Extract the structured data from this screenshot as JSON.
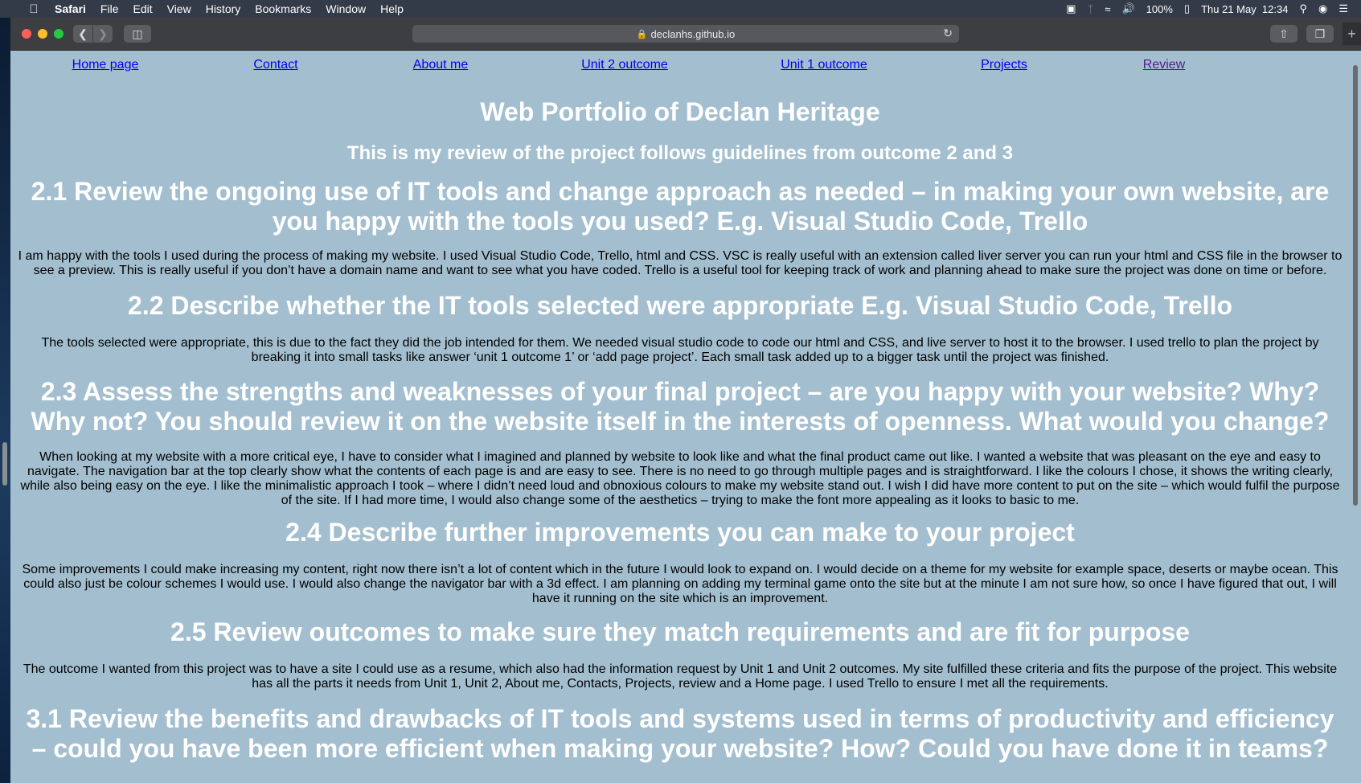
{
  "menubar": {
    "app": "Safari",
    "items": [
      "File",
      "Edit",
      "View",
      "History",
      "Bookmarks",
      "Window",
      "Help"
    ],
    "battery": "100%",
    "clock": "Thu 21 May  12:34"
  },
  "browser": {
    "url": "declanhs.github.io"
  },
  "nav": {
    "links": [
      "Home page",
      "Contact",
      "About me",
      "Unit 2 outcome",
      "Unit 1 outcome",
      "Projects",
      "Review"
    ]
  },
  "page": {
    "title": "Web Portfolio of Declan Heritage",
    "subtitle": "This is my review of the project follows guidelines from outcome 2 and 3",
    "sections": [
      {
        "heading": "2.1 Review the ongoing use of IT tools and change approach as needed – in making your own website, are you happy with the tools you used? E.g. Visual Studio Code, Trello",
        "body": "I am happy with the tools I used during the process of making my website. I used Visual Studio Code, Trello, html and CSS. VSC is really useful with an extension called liver server you can run your html and CSS file in the browser to see a preview. This is really useful if you don’t have a domain name and want to see what you have coded. Trello is a useful tool for keeping track of work and planning ahead to make sure the project was done on time or before."
      },
      {
        "heading": "2.2 Describe whether the IT tools selected were appropriate E.g. Visual Studio Code, Trello",
        "body": "The tools selected were appropriate, this is due to the fact they did the job intended for them. We needed visual studio code to code our html and CSS, and live server to host it to the browser. I used trello to plan the project by breaking it into small tasks like answer ‘unit 1 outcome 1’ or ‘add page project’. Each small task added up to a bigger task until the project was finished."
      },
      {
        "heading": "2.3 Assess the strengths and weaknesses of your final project – are you happy with your website? Why? Why not? You should review it on the website itself in the interests of openness. What would you change?",
        "body": "When looking at my website with a more critical eye, I have to consider what I imagined and planned by website to look like and what the final product came out like. I wanted a website that was pleasant on the eye and easy to navigate. The navigation bar at the top clearly show what the contents of each page is and are easy to see. There is no need to go through multiple pages and is straightforward. I like the colours I chose, it shows the writing clearly, while also being easy on the eye. I like the minimalistic approach I took – where I didn’t need loud and obnoxious colours to make my website stand out. I wish I did have more content to put on the site – which would fulfil the purpose of the site. If I had more time, I would also change some of the aesthetics – trying to make the font more appealing as it looks to basic to me."
      },
      {
        "heading": "2.4 Describe further improvements you can make to your project",
        "body": "Some improvements I could make increasing my content, right now there isn’t a lot of content which in the future I would look to expand on. I would decide on a theme for my website for example space, deserts or maybe ocean. This could also just be colour schemes I would use. I would also change the navigator bar with a 3d effect. I am planning on adding my terminal game onto the site but at the minute I am not sure how, so once I have figured that out, I will have it running on the site which is an improvement."
      },
      {
        "heading": "2.5 Review outcomes to make sure they match requirements and are fit for purpose",
        "body": "The outcome I wanted from this project was to have a site I could use as a resume, which also had the information request by Unit 1 and Unit 2 outcomes. My site fulfilled these criteria and fits the purpose of the project. This website has all the parts it needs from Unit 1, Unit 2, About me, Contacts, Projects, review and a Home page. I used Trello to ensure I met all the requirements."
      },
      {
        "heading": "3.1 Review the benefits and drawbacks of IT tools and systems used in terms of productivity and efficiency – could you have been more efficient when making your website? How? Could you have done it in teams?",
        "body": ""
      }
    ]
  }
}
